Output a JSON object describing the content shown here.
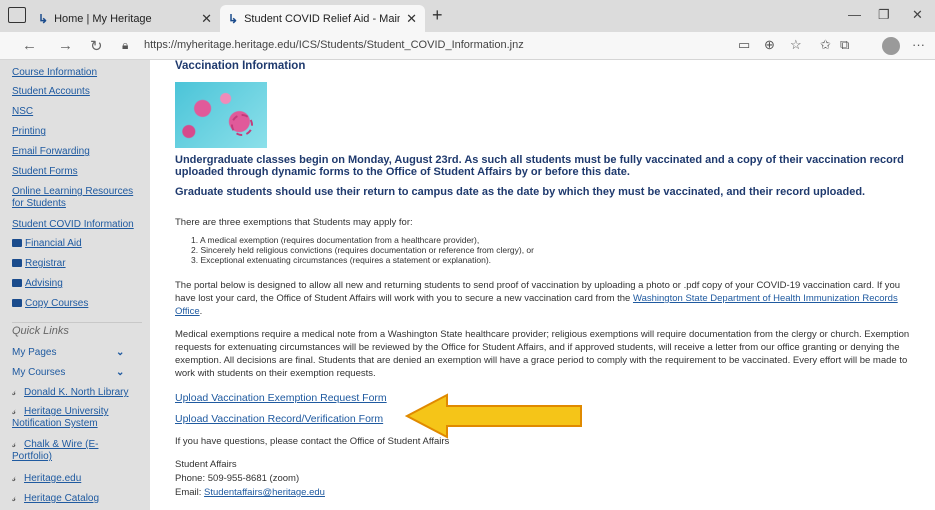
{
  "browser": {
    "tab1_title": "Home | My Heritage",
    "tab2_title": "Student COVID Relief Aid - Main",
    "url": "https://myheritage.heritage.edu/ICS/Students/Student_COVID_Information.jnz"
  },
  "sidebar": {
    "items": [
      {
        "label": "Course Information"
      },
      {
        "label": "Student Accounts"
      },
      {
        "label": "NSC"
      },
      {
        "label": "Printing"
      },
      {
        "label": "Email Forwarding"
      },
      {
        "label": "Student Forms"
      },
      {
        "label": "Online Learning Resources for Students"
      },
      {
        "label": "Student COVID Information"
      },
      {
        "label": "Financial Aid"
      },
      {
        "label": "Registrar"
      },
      {
        "label": "Advising"
      },
      {
        "label": "Copy Courses"
      }
    ],
    "quick_links_heading": "Quick Links",
    "quick_links": [
      {
        "label": "My Pages"
      },
      {
        "label": "My Courses"
      },
      {
        "label": "Donald K. North Library"
      },
      {
        "label": "Heritage University Notification System"
      },
      {
        "label": "Chalk & Wire (E-Portfolio)"
      },
      {
        "label": "Heritage.edu"
      },
      {
        "label": "Heritage Catalog"
      }
    ]
  },
  "main": {
    "title": "Vaccination Information",
    "undergrad_notice": "Undergraduate classes begin on Monday, August 23rd. As such all students must be fully vaccinated and a copy of their vaccination record uploaded through dynamic forms to the Office of Student Affairs by or before this date.",
    "grad_notice": "Graduate students should use their return to campus date as the date by which they must be vaccinated, and their record uploaded.",
    "exemptions_intro": "There are three exemptions that Students may apply for:",
    "exemptions": [
      "1. A medical exemption (requires documentation from a healthcare provider),",
      "2. Sincerely held religious convictions (requires documentation or reference from clergy), or",
      "3. Exceptional extenuating circumstances (requires a statement or explanation)."
    ],
    "portal_text": "The portal below is designed to allow all new and returning students to send proof of vaccination by uploading a photo or .pdf copy of your COVID-19 vaccination card. If you have lost your card, the Office of Student Affairs will work with you to secure a new vaccination card from the",
    "portal_link": "Washington State Department of Health Immunization Records Office",
    "medical_text": "Medical exemptions require a medical note from a Washington State healthcare provider; religious exemptions will require documentation from the clergy or church.  Exemption requests for extenuating circumstances will be reviewed by the Office for Student Affairs, and if approved students, will receive a letter from our office granting or denying the exemption.  All decisions are final.  Students that are denied an exemption will have a grace period to comply with the requirement to be vaccinated.  Every effort will be made to work with students on their exemption requests.",
    "link_exemption": "Upload Vaccination Exemption Request Form",
    "link_record": "Upload Vaccination Record/Verification Form",
    "questions": "If you have questions, please contact the Office of Student Affairs",
    "contact_name": "Student Affairs",
    "contact_phone": "Phone: 509-955-8681 (zoom)",
    "contact_email_label": "Email:",
    "contact_email": "Studentaffairs@heritage.edu"
  },
  "colors": {
    "heading_blue": "#1f3a6e",
    "link_blue": "#1f5aa0",
    "sidebar_bg": "#e0e0e0",
    "arrow_fill": "#f5c518",
    "arrow_stroke": "#e08a00"
  }
}
